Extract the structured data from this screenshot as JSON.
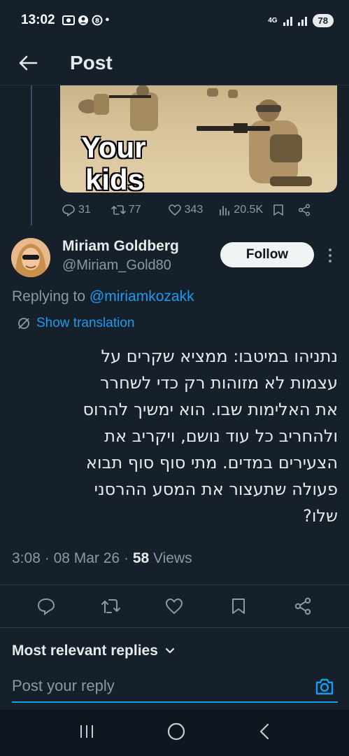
{
  "status_bar": {
    "time": "13:02",
    "network": "4G",
    "battery": "78"
  },
  "header": {
    "title": "Post"
  },
  "media": {
    "overlay_line1": "Your",
    "overlay_line2": "kids"
  },
  "parent_stats": {
    "replies": "31",
    "reposts": "77",
    "likes": "343",
    "views": "20.5K"
  },
  "author": {
    "name": "Miriam Goldberg",
    "handle": "@Miriam_Gold80",
    "follow_label": "Follow"
  },
  "reply_context": {
    "prefix": "Replying to",
    "user": "@miriamkozakk"
  },
  "translate_label": "Show translation",
  "tweet": {
    "lines": [
      "נתניהו במיטבו: ממציא שקרים על",
      "עצמות לא מזוהות רק כדי לשחרר",
      "את האלימות שבו. הוא ימשיך להרוס",
      "ולהחריב כל עוד נושם, ויקריב את",
      "הצעירים במדים. מתי סוף סוף תבוא",
      "פעולה שתעצור את המסע ההרסני",
      "שלו?"
    ]
  },
  "meta": {
    "time": "3:08",
    "date": "08 Mar 26",
    "views_count": "58",
    "views_label": "Views"
  },
  "replies_section": {
    "sort_label": "Most relevant replies",
    "placeholder": "Post your reply"
  },
  "colors": {
    "background": "#15202b",
    "accent": "#1d9bf0",
    "muted": "#8b98a5"
  }
}
